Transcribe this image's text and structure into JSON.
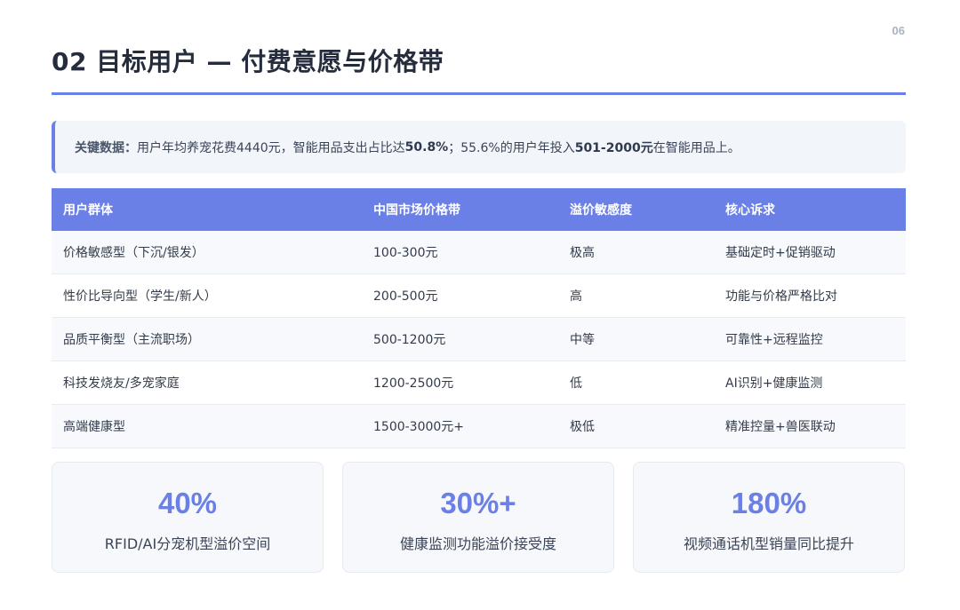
{
  "page_number": "06",
  "title": "02 目标用户 — 付费意愿与价格带",
  "callout": {
    "lead": "关键数据：",
    "part1": "用户年均养宠花费4440元，智能用品支出占比达",
    "bold1": "50.8%",
    "part2": "；55.6%的用户年投入",
    "bold2": "501-2000元",
    "part3": "在智能用品上。"
  },
  "table": {
    "headers": [
      "用户群体",
      "中国市场价格带",
      "溢价敏感度",
      "核心诉求"
    ],
    "rows": [
      [
        "价格敏感型（下沉/银发）",
        "100-300元",
        "极高",
        "基础定时+促销驱动"
      ],
      [
        "性价比导向型（学生/新人）",
        "200-500元",
        "高",
        "功能与价格严格比对"
      ],
      [
        "品质平衡型（主流职场）",
        "500-1200元",
        "中等",
        "可靠性+远程监控"
      ],
      [
        "科技发烧友/多宠家庭",
        "1200-2500元",
        "低",
        "AI识别+健康监测"
      ],
      [
        "高端健康型",
        "1500-3000元+",
        "极低",
        "精准控量+兽医联动"
      ]
    ]
  },
  "stats": [
    {
      "value": "40%",
      "label": "RFID/AI分宠机型溢价空间"
    },
    {
      "value": "30%+",
      "label": "健康监测功能溢价接受度"
    },
    {
      "value": "180%",
      "label": "视频通话机型销量同比提升"
    }
  ],
  "colors": {
    "accent": "#6b80e6",
    "callout_bg": "#f2f5fa",
    "card_bg": "#f6f8fc"
  }
}
